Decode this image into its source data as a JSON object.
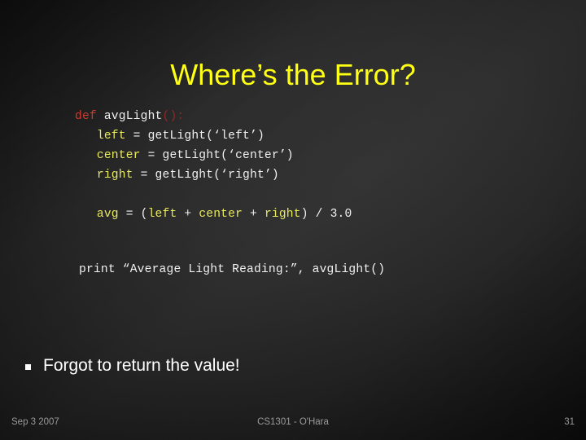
{
  "slide": {
    "title": "Where’s the Error?",
    "title_color": "#ffff14",
    "background_color": "#2c2c2c"
  },
  "code": {
    "font": "monospace",
    "lines": [
      {
        "id": "def-line",
        "tokens": [
          {
            "text": "def",
            "style": "kw"
          },
          {
            "text": " avgLight",
            "style": "plain"
          },
          {
            "text": "():",
            "style": "kw-dim"
          }
        ]
      },
      {
        "id": "left-line",
        "tokens": [
          {
            "text": "   ",
            "style": "plain"
          },
          {
            "text": "left",
            "style": "var"
          },
          {
            "text": " = getLight(‘left’)",
            "style": "plain"
          }
        ]
      },
      {
        "id": "center-line",
        "tokens": [
          {
            "text": "   ",
            "style": "plain"
          },
          {
            "text": "center",
            "style": "var"
          },
          {
            "text": " = getLight(‘center’)",
            "style": "plain"
          }
        ]
      },
      {
        "id": "right-line",
        "tokens": [
          {
            "text": "   ",
            "style": "plain"
          },
          {
            "text": "right",
            "style": "var"
          },
          {
            "text": " = getLight(‘right’)",
            "style": "plain"
          }
        ]
      },
      {
        "id": "blank-1",
        "tokens": []
      },
      {
        "id": "avg-line",
        "tokens": [
          {
            "text": "   ",
            "style": "plain"
          },
          {
            "text": "avg",
            "style": "var"
          },
          {
            "text": " = (",
            "style": "plain"
          },
          {
            "text": "left",
            "style": "var"
          },
          {
            "text": " + ",
            "style": "plain"
          },
          {
            "text": "center",
            "style": "var"
          },
          {
            "text": " + ",
            "style": "plain"
          },
          {
            "text": "right",
            "style": "var"
          },
          {
            "text": ") / 3.0",
            "style": "plain"
          }
        ]
      }
    ],
    "print_line": "print “Average Light Reading:”, avgLight()",
    "colors": {
      "keyword": "#cf3b2e",
      "keyword_dim": "#8e2a22",
      "variable": "#e9e95c",
      "plain": "#f1f1f1"
    }
  },
  "bullet": {
    "marker": "square-bullet",
    "text": "Forgot to return the value!"
  },
  "footer": {
    "date": "Sep 3 2007",
    "center": "CS1301 - O'Hara",
    "page": "31"
  }
}
